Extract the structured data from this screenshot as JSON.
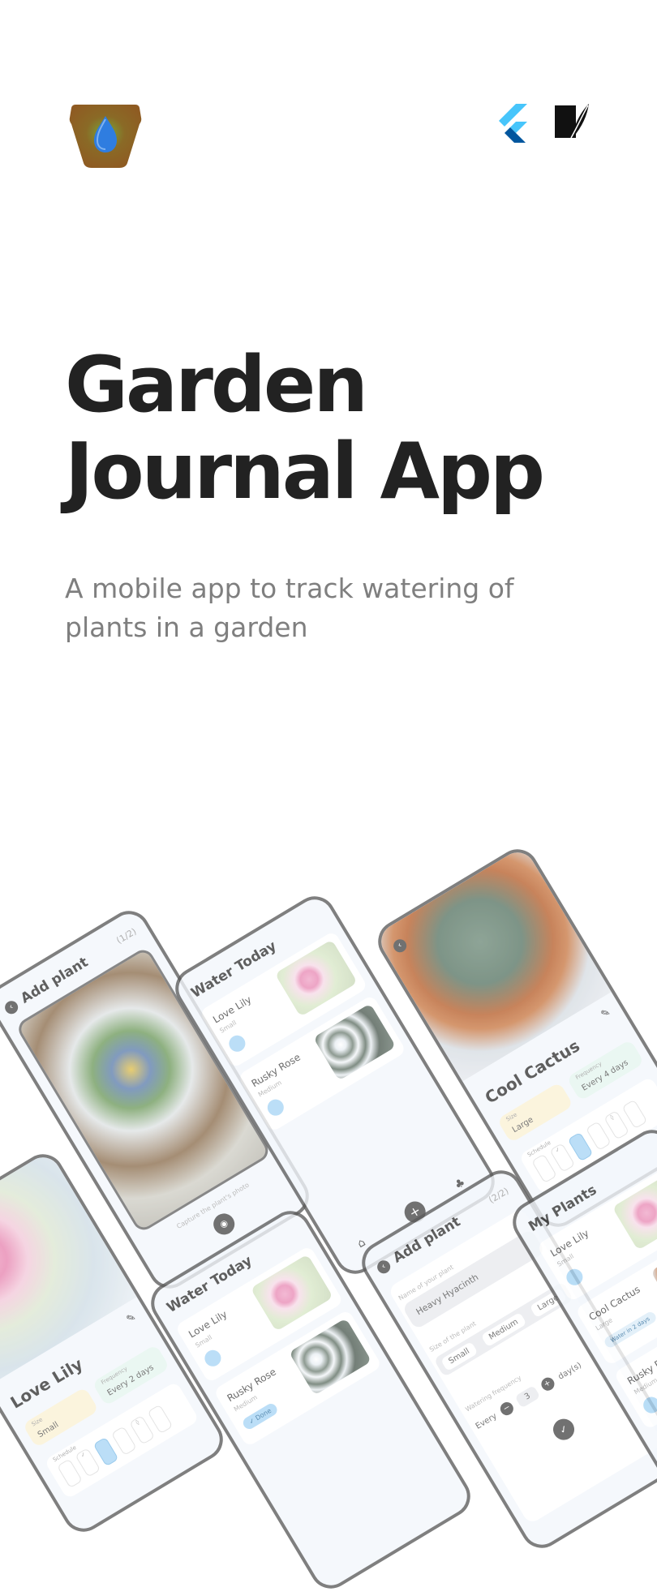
{
  "logo": {
    "icon": "water-drop-pot-icon"
  },
  "tech": {
    "icons": [
      "flutter-icon",
      "feather-book-icon"
    ]
  },
  "hero": {
    "title_line1": "Garden",
    "title_line2": "Journal App",
    "subtitle": "A mobile app to track watering of plants in a garden"
  },
  "colors": {
    "pot": "#8f5a22",
    "drop": "#2f7de0",
    "flutter": "#42a5f5",
    "title": "#222222",
    "subtitle": "#7f7f7f",
    "phone_bg": "#f3f7fc"
  },
  "mockups": {
    "add_plant_1": {
      "title": "Add plant",
      "step": "(1/2)",
      "caption": "Capture the plant's photo"
    },
    "water_today_1": {
      "title": "Water Today",
      "plants": [
        {
          "name": "Love Lily",
          "size": "Small"
        },
        {
          "name": "Rusky Rose",
          "size": "Medium"
        }
      ]
    },
    "cool_cactus": {
      "name": "Cool Cactus",
      "size_label": "Size",
      "size": "Large",
      "freq_label": "Frequency",
      "freq": "Every 4 days",
      "schedule_label": "Schedule"
    },
    "love_lily": {
      "name": "Love Lily",
      "size_label": "Size",
      "size": "Small",
      "freq_label": "Frequency",
      "freq": "Every 2 days",
      "schedule_label": "Schedule"
    },
    "water_today_2": {
      "title": "Water Today",
      "plants": [
        {
          "name": "Love Lily",
          "size": "Small"
        },
        {
          "name": "Rusky Rose",
          "size": "Medium"
        }
      ],
      "done": "Done"
    },
    "add_plant_2": {
      "title": "Add plant",
      "step": "(2/2)",
      "name_label": "Name of your plant",
      "name_value": "Heavy Hyacinth",
      "size_label": "Size of the plant",
      "sizes": [
        "Small",
        "Medium",
        "Large"
      ],
      "freq_label": "Watering frequency",
      "every": "Every",
      "count": "3",
      "unit": "day(s)"
    },
    "my_plants": {
      "title": "My Plants",
      "plants": [
        {
          "name": "Love Lily",
          "size": "Small"
        },
        {
          "name": "Cool Cactus",
          "size": "Large"
        },
        {
          "name": "Rusky Rose",
          "size": "Medium"
        }
      ],
      "badge": "Water in 2 days"
    }
  }
}
